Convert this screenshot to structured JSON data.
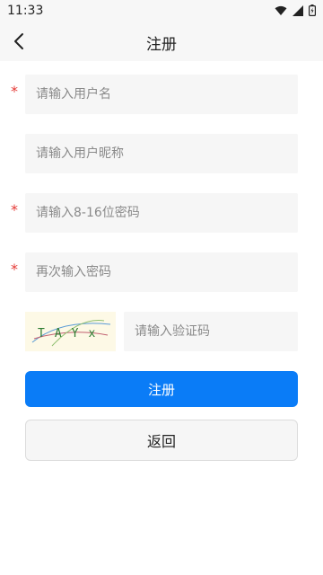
{
  "status_bar": {
    "time": "11:33",
    "icons": [
      "wifi-icon",
      "signal-icon",
      "battery-icon"
    ]
  },
  "header": {
    "title": "注册",
    "back_icon": "chevron-left-icon"
  },
  "form": {
    "required_mark": "*",
    "username_placeholder": "请输入用户名",
    "nickname_placeholder": "请输入用户昵称",
    "password_placeholder": "请输入8-16位密码",
    "confirm_password_placeholder": "再次输入密码",
    "captcha_text": "TAYx",
    "captcha_placeholder": "请输入验证码"
  },
  "actions": {
    "register_label": "注册",
    "back_label": "返回"
  },
  "colors": {
    "accent": "#0a7cf7",
    "required": "#e53935",
    "field_bg": "#f6f6f6",
    "captcha_bg": "#fdf9e6"
  }
}
